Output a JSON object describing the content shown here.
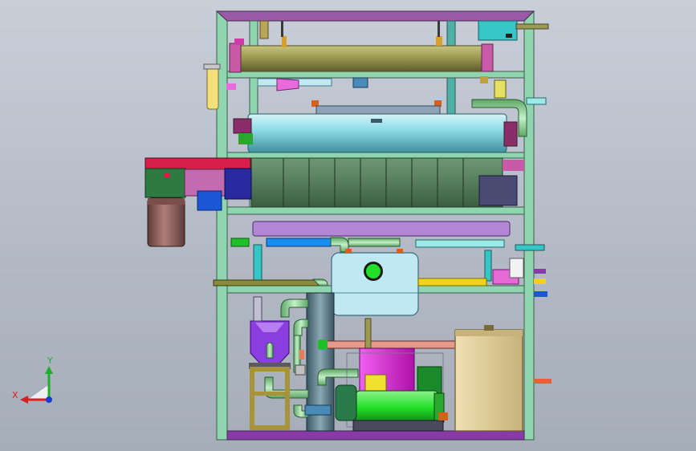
{
  "viewport": {
    "background_top": "#c9cfd9",
    "background_bottom": "#a5adb9"
  },
  "triad": {
    "x_label": "X",
    "y_label": "Y",
    "x_color": "#d62020",
    "y_color": "#1fae2a",
    "z_color": "#1a3bd6"
  },
  "colors": {
    "frame": "#8fd6b0",
    "frame_edge": "#3c5a48",
    "top_rail": "#9a5aa8",
    "base_rail": "#8a3aa8",
    "condenser": "#9c9a52",
    "evaporator": "#8fdde6",
    "fin_block": "#4f7a57",
    "purple_pump": "#8a3ee0",
    "green_compressor": "#22e028",
    "magenta_tank": "#e020d6",
    "tan_box": "#e0cc96",
    "light_tank": "#bfe8f3",
    "pipe_green": "#9adca2",
    "pipe_cyan": "#36c6c6",
    "pipe_blue": "#1a56d6",
    "pipe_yellow": "#f0d21a",
    "pipe_salmon": "#e59a8a",
    "motor_brown": "#8c5e5a",
    "red_housing": "#d81e4a"
  }
}
